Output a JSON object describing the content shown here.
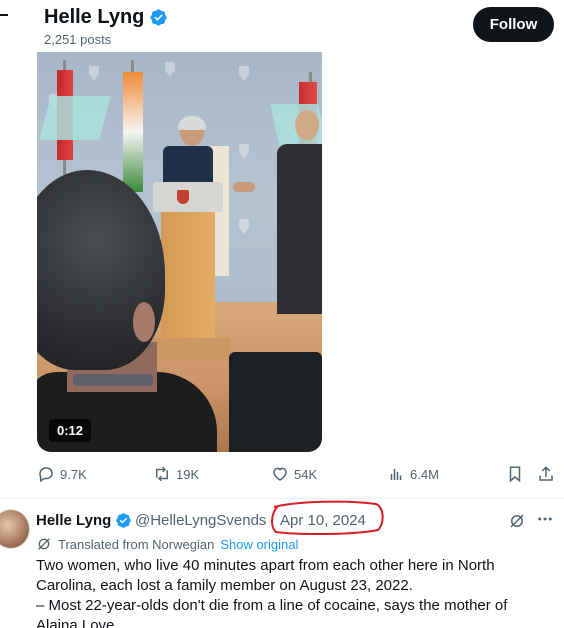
{
  "profile_header": {
    "name": "Helle Lyng",
    "post_count": "2,251 posts",
    "follow_label": "Follow"
  },
  "video": {
    "duration": "0:12"
  },
  "actions": {
    "replies": "9.7K",
    "reposts": "19K",
    "likes": "54K",
    "views": "6.4M"
  },
  "tweet": {
    "author_name": "Helle Lyng",
    "handle": "@HelleLyngSvends",
    "date": "Apr 10, 2024",
    "translated_label": "Translated from Norwegian",
    "show_original_label": "Show original",
    "text_line1": "Two women, who live 40 minutes apart from each other here in North",
    "text_line2": "Carolina, each lost a family member on August 23, 2022.",
    "text_line3": "– Most 22-year-olds don't die from a line of cocaine, says the mother of",
    "text_line4": "Alaina Love"
  },
  "colors": {
    "verified_blue": "#1d9bf0",
    "annotation_red": "#d61f26",
    "muted_text": "#536471"
  }
}
